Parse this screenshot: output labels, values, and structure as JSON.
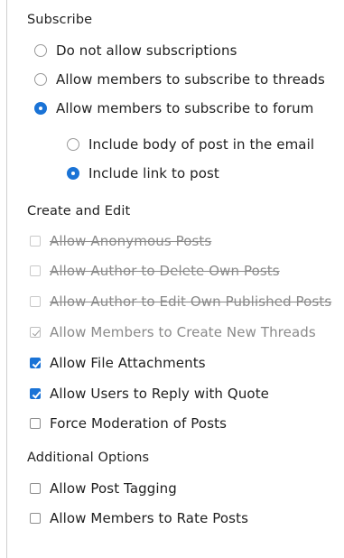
{
  "subscribe": {
    "title": "Subscribe",
    "options": [
      {
        "label": "Do not allow subscriptions",
        "selected": false
      },
      {
        "label": "Allow members to subscribe to threads",
        "selected": false
      },
      {
        "label": "Allow members to subscribe to forum",
        "selected": true
      }
    ],
    "sub_options": [
      {
        "label": "Include body of post in the email",
        "selected": false
      },
      {
        "label": "Include link to post",
        "selected": true
      }
    ]
  },
  "create_edit": {
    "title": "Create and Edit",
    "items": [
      {
        "label": "Allow Anonymous Posts",
        "checked": false,
        "disabled": true
      },
      {
        "label": "Allow Author to Delete Own Posts",
        "checked": false,
        "disabled": true
      },
      {
        "label": "Allow Author to Edit Own Published Posts",
        "checked": false,
        "disabled": true
      },
      {
        "label": "Allow Members to Create New Threads",
        "checked": true,
        "disabled": true
      },
      {
        "label": "Allow File Attachments",
        "checked": true,
        "disabled": false
      },
      {
        "label": "Allow Users to Reply with Quote",
        "checked": true,
        "disabled": false
      },
      {
        "label": "Force Moderation of Posts",
        "checked": false,
        "disabled": false
      }
    ]
  },
  "additional": {
    "title": "Additional Options",
    "items": [
      {
        "label": "Allow Post Tagging",
        "checked": false
      },
      {
        "label": "Allow Members to Rate Posts",
        "checked": false
      }
    ]
  },
  "colors": {
    "accent": "#1a73d6",
    "disabled_text": "#8a8a8a"
  }
}
